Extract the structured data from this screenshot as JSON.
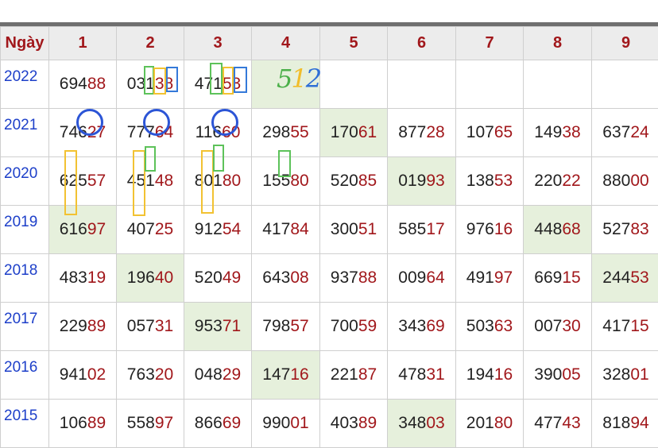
{
  "table": {
    "header": [
      "Ngày",
      "1",
      "2",
      "3",
      "4",
      "5",
      "6",
      "7",
      "8",
      "9"
    ],
    "rows": [
      {
        "year": "2022",
        "cells": [
          [
            "694",
            "88"
          ],
          [
            "031",
            "38"
          ],
          [
            "471",
            "53"
          ],
          [
            "",
            ""
          ],
          [
            "",
            ""
          ],
          [
            "",
            ""
          ],
          [
            "",
            ""
          ],
          [
            "",
            ""
          ],
          [
            "",
            ""
          ]
        ]
      },
      {
        "year": "2021",
        "cells": [
          [
            "746",
            "27"
          ],
          [
            "777",
            "64"
          ],
          [
            "116",
            "60"
          ],
          [
            "298",
            "55"
          ],
          [
            "170",
            "61"
          ],
          [
            "877",
            "28"
          ],
          [
            "107",
            "65"
          ],
          [
            "149",
            "38"
          ],
          [
            "637",
            "24"
          ]
        ]
      },
      {
        "year": "2020",
        "cells": [
          [
            "625",
            "57"
          ],
          [
            "451",
            "48"
          ],
          [
            "801",
            "80"
          ],
          [
            "155",
            "80"
          ],
          [
            "520",
            "85"
          ],
          [
            "019",
            "93"
          ],
          [
            "138",
            "53"
          ],
          [
            "220",
            "22"
          ],
          [
            "880",
            "00"
          ]
        ]
      },
      {
        "year": "2019",
        "cells": [
          [
            "616",
            "97"
          ],
          [
            "407",
            "25"
          ],
          [
            "912",
            "54"
          ],
          [
            "417",
            "84"
          ],
          [
            "300",
            "51"
          ],
          [
            "585",
            "17"
          ],
          [
            "976",
            "16"
          ],
          [
            "448",
            "68"
          ],
          [
            "527",
            "83"
          ]
        ]
      },
      {
        "year": "2018",
        "cells": [
          [
            "483",
            "19"
          ],
          [
            "196",
            "40"
          ],
          [
            "520",
            "49"
          ],
          [
            "643",
            "08"
          ],
          [
            "937",
            "88"
          ],
          [
            "009",
            "64"
          ],
          [
            "491",
            "97"
          ],
          [
            "669",
            "15"
          ],
          [
            "244",
            "53"
          ]
        ]
      },
      {
        "year": "2017",
        "cells": [
          [
            "229",
            "89"
          ],
          [
            "057",
            "31"
          ],
          [
            "953",
            "71"
          ],
          [
            "798",
            "57"
          ],
          [
            "700",
            "59"
          ],
          [
            "343",
            "69"
          ],
          [
            "503",
            "63"
          ],
          [
            "007",
            "30"
          ],
          [
            "417",
            "15"
          ]
        ]
      },
      {
        "year": "2016",
        "cells": [
          [
            "941",
            "02"
          ],
          [
            "763",
            "20"
          ],
          [
            "048",
            "29"
          ],
          [
            "147",
            "16"
          ],
          [
            "221",
            "87"
          ],
          [
            "478",
            "31"
          ],
          [
            "194",
            "16"
          ],
          [
            "390",
            "05"
          ],
          [
            "328",
            "01"
          ]
        ]
      },
      {
        "year": "2015",
        "cells": [
          [
            "106",
            "89"
          ],
          [
            "558",
            "97"
          ],
          [
            "866",
            "69"
          ],
          [
            "990",
            "01"
          ],
          [
            "403",
            "89"
          ],
          [
            "348",
            "03"
          ],
          [
            "201",
            "80"
          ],
          [
            "477",
            "43"
          ],
          [
            "818",
            "94"
          ]
        ]
      }
    ],
    "highlights": [
      [
        0,
        3
      ],
      [
        1,
        4
      ],
      [
        2,
        5
      ],
      [
        3,
        0
      ],
      [
        3,
        7
      ],
      [
        4,
        1
      ],
      [
        4,
        8
      ],
      [
        5,
        2
      ],
      [
        6,
        3
      ],
      [
        7,
        5
      ]
    ]
  },
  "annotation": {
    "handwritten": [
      "5",
      "1",
      "2"
    ]
  },
  "colors": {
    "header_text": "#a1171b",
    "year_text": "#1d3fc9",
    "highlight_bg": "#e6f0dc",
    "accent": "#a1171b"
  }
}
